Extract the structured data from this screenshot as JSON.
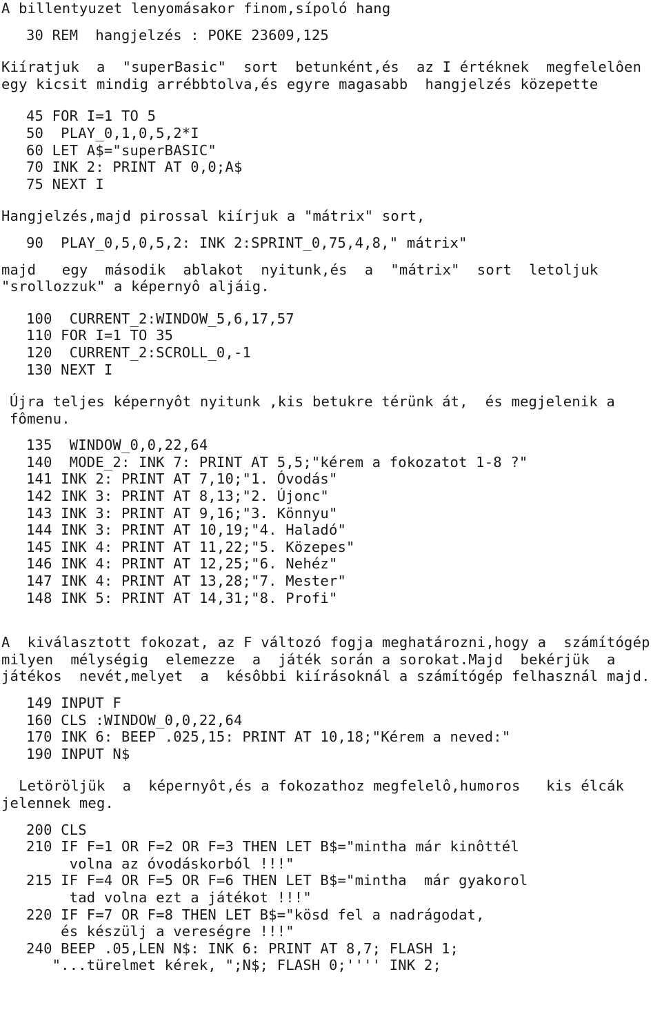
{
  "document": {
    "language": "hu",
    "page_type": "book-page-scan",
    "title_line": "A billentyuzet lenyomásakor finom,sípoló hang"
  },
  "blocks": {
    "listing_1": "30 REM  hangjelzés : POKE 23609,125",
    "para_1": "Kiíratjuk  a  \"superBasic\"  sort  betunként,és  az I értéknek  megfelelôen\negy kicsit mindig arrébbtolva,és egyre magasabb  hangjelzés közepette",
    "listing_2": "45 FOR I=1 TO 5\n50  PLAY_0,1,0,5,2*I\n60 LET A$=\"superBASIC\"\n70 INK 2: PRINT AT 0,0;A$\n75 NEXT I",
    "para_2": "Hangjelzés,majd pirossal kiírjuk a \"mátrix\" sort,",
    "listing_3": "90  PLAY_0,5,0,5,2: INK 2:SPRINT_0,75,4,8,\" mátrix\"",
    "para_3": "majd   egy  második  ablakot  nyitunk,és  a  \"mátrix\"  sort  letoljuk\n\"srollozzuk\" a képernyô aljáig.",
    "listing_4": "100  CURRENT_2:WINDOW_5,6,17,57\n110 FOR I=1 TO 35\n120  CURRENT_2:SCROLL_0,-1\n130 NEXT I",
    "para_4": "Újra teljes képernyôt nyitunk ,kis betukre térünk át,  és megjelenik a\nfômenu.",
    "listing_5": "135  WINDOW_0,0,22,64\n140  MODE_2: INK 7: PRINT AT 5,5;\"kérem a fokozatot 1-8 ?\"\n141 INK 2: PRINT AT 7,10;\"1. Óvodás\"\n142 INK 3: PRINT AT 8,13;\"2. Újonc\"\n143 INK 3: PRINT AT 9,16;\"3. Könnyu\"\n144 INK 3: PRINT AT 10,19;\"4. Haladó\"\n145 INK 4: PRINT AT 11,22;\"5. Közepes\"\n146 INK 4: PRINT AT 12,25;\"6. Nehéz\"\n147 INK 4: PRINT AT 13,28;\"7. Mester\"\n148 INK 5: PRINT AT 14,31;\"8. Profi\"",
    "para_5": "A  kiválasztott fokozat, az F változó fogja meghatározni,hogy a  számítógép\nmilyen  mélységig  elemezze  a  játék során a sorokat.Majd  bekérjük  a\njátékos  nevét,melyet  a  késôbbi kiírásoknál a számítógép felhasznál majd.",
    "listing_6": "149 INPUT F\n160 CLS :WINDOW_0,0,22,64\n170 INK 6: BEEP .025,15: PRINT AT 10,18;\"Kérem a neved:\"\n190 INPUT N$",
    "para_6": "  Letöröljük  a  képernyôt,és a fokozathoz megfelelô,humoros   kis élcák\njelennek meg.",
    "listing_7": "200 CLS\n210 IF F=1 OR F=2 OR F=3 THEN LET B$=\"mintha már kinôttél\n     volna az óvodáskorból !!!\"\n215 IF F=4 OR F=5 OR F=6 THEN LET B$=\"mintha  már gyakorol\n     tad volna ezt a játékot !!!\"\n220 IF F=7 OR F=8 THEN LET B$=\"kösd fel a nadrágodat,\n    és készülj a vereségre !!!\"\n240 BEEP .05,LEN N$: INK 6: PRINT AT 8,7; FLASH 1;\n   \"...türelmet kérek, \";N$; FLASH 0;'''' INK 2;"
  }
}
